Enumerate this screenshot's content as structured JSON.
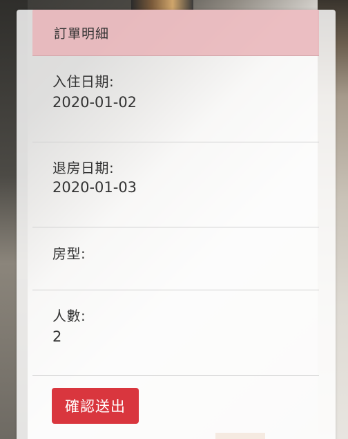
{
  "order": {
    "title": "訂單明細",
    "fields": [
      {
        "label": "入住日期:",
        "value": "2020-01-02"
      },
      {
        "label": "退房日期:",
        "value": "2020-01-03"
      },
      {
        "label": "房型:",
        "value": ""
      },
      {
        "label": "人數:",
        "value": "2"
      }
    ],
    "submit_label": "確認送出"
  },
  "colors": {
    "header_bg": "#e9b4b9",
    "button_bg": "#d9363e",
    "button_text": "#ffffff"
  }
}
